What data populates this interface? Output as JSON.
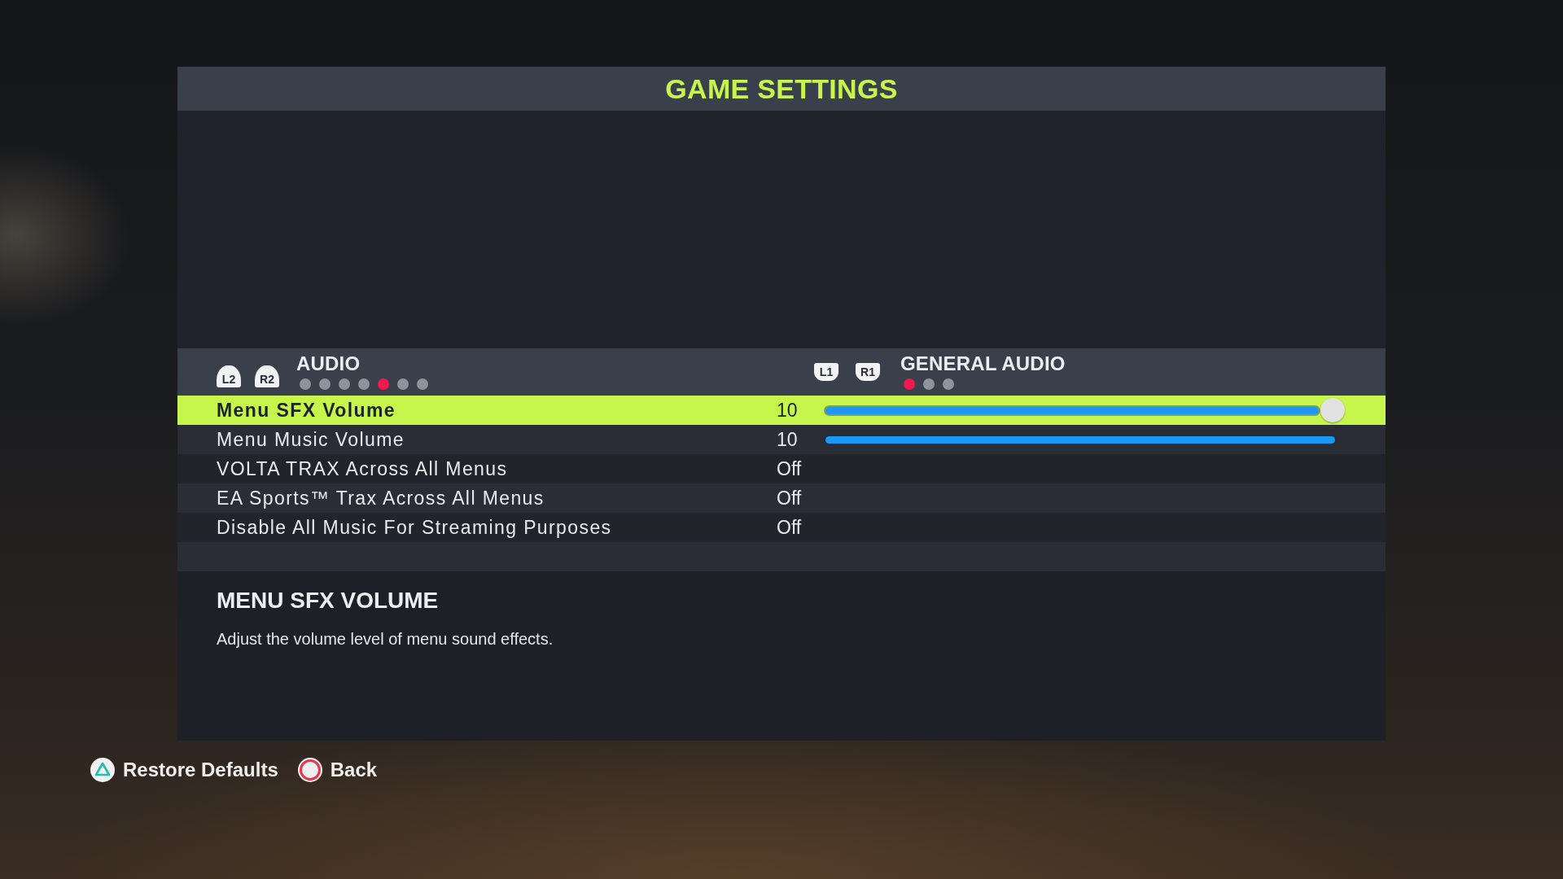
{
  "window": {
    "title": "GAME SETTINGS"
  },
  "category": {
    "keys": [
      {
        "label": "L2",
        "kind": "trigger"
      },
      {
        "label": "R2",
        "kind": "trigger"
      }
    ],
    "label": "AUDIO",
    "pages": [
      {
        "selected": false
      },
      {
        "selected": false
      },
      {
        "selected": false
      },
      {
        "selected": false
      },
      {
        "selected": true
      },
      {
        "selected": false
      },
      {
        "selected": false
      }
    ]
  },
  "section": {
    "keys": [
      {
        "label": "L1",
        "kind": "bumper"
      },
      {
        "label": "R1",
        "kind": "bumper"
      }
    ],
    "label": "GENERAL AUDIO",
    "pages": [
      {
        "selected": true
      },
      {
        "selected": false
      },
      {
        "selected": false
      }
    ]
  },
  "settings": [
    {
      "label": "Menu SFX Volume",
      "value": "10",
      "kind": "slider",
      "level": 1,
      "selected": true
    },
    {
      "label": "Menu Music Volume",
      "value": "10",
      "kind": "slider",
      "level": 1,
      "selected": false
    },
    {
      "label": "VOLTA TRAX Across All Menus",
      "value": "Off",
      "kind": "toggle",
      "selected": false
    },
    {
      "label": "EA Sports™ Trax Across All Menus",
      "value": "Off",
      "kind": "toggle",
      "selected": false
    },
    {
      "label": "Disable All Music For Streaming Purposes",
      "value": "Off",
      "kind": "toggle",
      "selected": false
    }
  ],
  "description": {
    "title": "MENU SFX VOLUME",
    "text": "Adjust the volume level of menu sound effects."
  },
  "footer_buttons": [
    {
      "kind": "triangle",
      "label": "Restore Defaults"
    },
    {
      "kind": "circle",
      "label": "Back"
    }
  ]
}
